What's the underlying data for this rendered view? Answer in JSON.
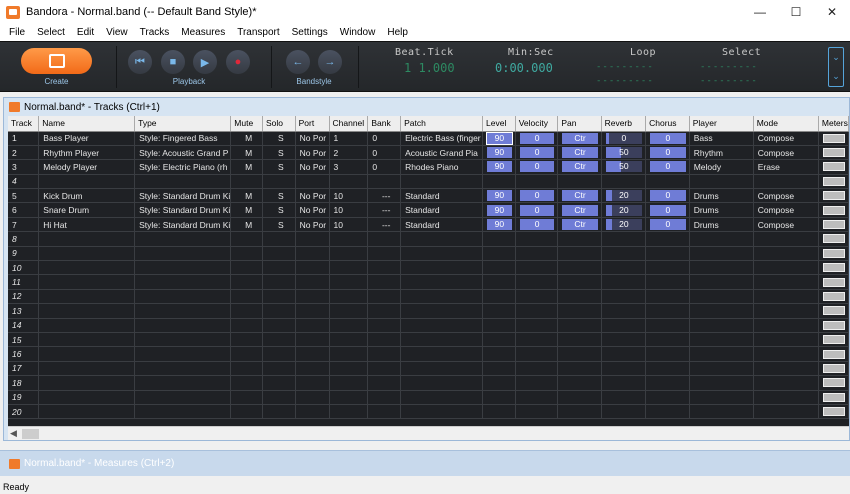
{
  "window": {
    "title": "Bandora - Normal.band (-- Default Band Style)*"
  },
  "menu": [
    "File",
    "Select",
    "Edit",
    "View",
    "Tracks",
    "Measures",
    "Transport",
    "Settings",
    "Window",
    "Help"
  ],
  "toolbar": {
    "create_label": "Create",
    "playback_label": "Playback",
    "bandstyle_label": "Bandstyle",
    "beat_tick": {
      "label": "Beat.Tick",
      "value": "1 1.000"
    },
    "min_sec": {
      "label": "Min:Sec",
      "value": "0:00.000"
    },
    "loop": {
      "label": "Loop",
      "line1": "---------",
      "line2": "---------"
    },
    "select": {
      "label": "Select",
      "line1": "---------",
      "line2": "---------"
    }
  },
  "tracks_window": {
    "title": "Normal.band* - Tracks (Ctrl+1)",
    "columns": [
      "Track",
      "Name",
      "Type",
      "Mute",
      "Solo",
      "Port",
      "Channel",
      "Bank",
      "Patch",
      "Level",
      "Velocity",
      "Pan",
      "Reverb",
      "Chorus",
      "Player",
      "Mode",
      "Meters"
    ],
    "rows": [
      {
        "track": "1",
        "name": "Bass Player",
        "type": "Style: Fingered Bass",
        "mute": "M",
        "solo": "S",
        "port": "No Por",
        "channel": "1",
        "bank": "0",
        "patch": "Electric Bass (finger",
        "level": "90",
        "velocity": "0",
        "pan": "Ctr",
        "reverb": "0",
        "chorus": "0",
        "player": "Bass",
        "mode": "Compose"
      },
      {
        "track": "2",
        "name": "Rhythm Player",
        "type": "Style: Acoustic Grand P",
        "mute": "M",
        "solo": "S",
        "port": "No Por",
        "channel": "2",
        "bank": "0",
        "patch": "Acoustic Grand Pia",
        "level": "90",
        "velocity": "0",
        "pan": "Ctr",
        "reverb": "50",
        "chorus": "0",
        "player": "Rhythm",
        "mode": "Compose"
      },
      {
        "track": "3",
        "name": "Melody Player",
        "type": "Style: Electric Piano (rh",
        "mute": "M",
        "solo": "S",
        "port": "No Por",
        "channel": "3",
        "bank": "0",
        "patch": "Rhodes Piano",
        "level": "90",
        "velocity": "0",
        "pan": "Ctr",
        "reverb": "50",
        "chorus": "0",
        "player": "Melody",
        "mode": "Erase"
      },
      {
        "track": "4"
      },
      {
        "track": "5",
        "name": "Kick Drum",
        "type": "Style: Standard Drum Ki",
        "mute": "M",
        "solo": "S",
        "port": "No Por",
        "channel": "10",
        "bank": "---",
        "patch": "Standard",
        "level": "90",
        "velocity": "0",
        "pan": "Ctr",
        "reverb": "20",
        "chorus": "0",
        "player": "Drums",
        "mode": "Compose"
      },
      {
        "track": "6",
        "name": "Snare Drum",
        "type": "Style: Standard Drum Ki",
        "mute": "M",
        "solo": "S",
        "port": "No Por",
        "channel": "10",
        "bank": "---",
        "patch": "Standard",
        "level": "90",
        "velocity": "0",
        "pan": "Ctr",
        "reverb": "20",
        "chorus": "0",
        "player": "Drums",
        "mode": "Compose"
      },
      {
        "track": "7",
        "name": "Hi Hat",
        "type": "Style: Standard Drum Ki",
        "mute": "M",
        "solo": "S",
        "port": "No Por",
        "channel": "10",
        "bank": "---",
        "patch": "Standard",
        "level": "90",
        "velocity": "0",
        "pan": "Ctr",
        "reverb": "20",
        "chorus": "0",
        "player": "Drums",
        "mode": "Compose"
      },
      {
        "track": "8"
      },
      {
        "track": "9"
      },
      {
        "track": "10"
      },
      {
        "track": "11"
      },
      {
        "track": "12"
      },
      {
        "track": "13"
      },
      {
        "track": "14"
      },
      {
        "track": "15"
      },
      {
        "track": "16"
      },
      {
        "track": "17"
      },
      {
        "track": "18"
      },
      {
        "track": "19"
      },
      {
        "track": "20"
      }
    ]
  },
  "measures_window": {
    "title": "Normal.band* - Measures (Ctrl+2)"
  },
  "status": {
    "text": "Ready"
  },
  "colors": {
    "toolbar_bg": "#2f3236",
    "create_orange": "#f26a18",
    "grid_bg": "#1f2125",
    "bar_blue": "#6f7cd6",
    "display_teal": "#3fa9a0"
  }
}
